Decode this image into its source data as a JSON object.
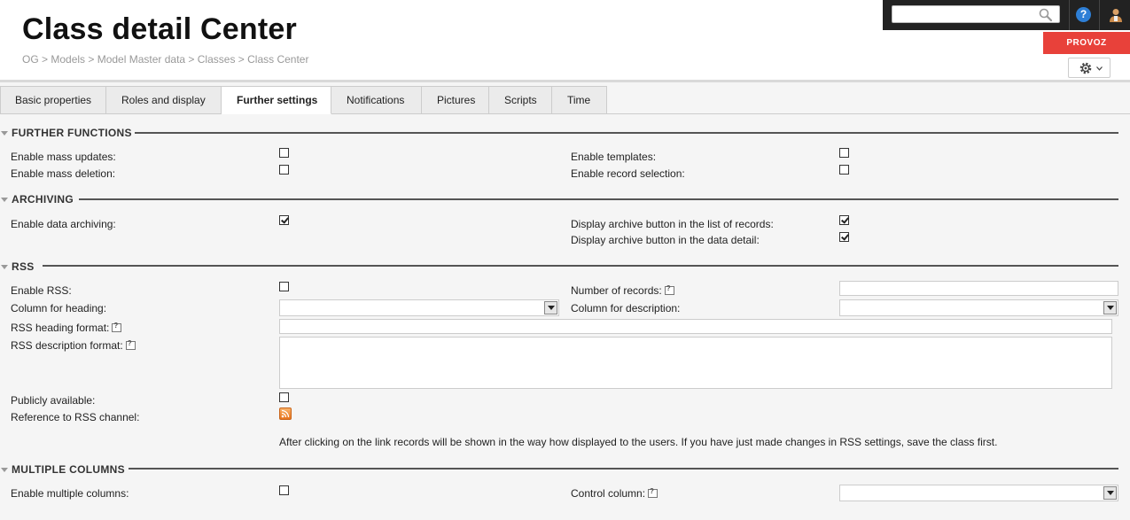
{
  "header": {
    "title": "Class detail Center",
    "breadcrumb": "OG > Models > Model Master data > Classes > Class Center",
    "search_value": "",
    "help_label": "?",
    "environment_badge": "PROVOZ"
  },
  "tabs": [
    {
      "label": "Basic properties",
      "active": false
    },
    {
      "label": "Roles and display",
      "active": false
    },
    {
      "label": "Further settings",
      "active": true
    },
    {
      "label": "Notifications",
      "active": false
    },
    {
      "label": "Pictures",
      "active": false
    },
    {
      "label": "Scripts",
      "active": false
    },
    {
      "label": "Time",
      "active": false
    }
  ],
  "further_functions": {
    "title": "FURTHER FUNCTIONS",
    "enable_mass_updates": {
      "label": "Enable mass updates:",
      "checked": false
    },
    "enable_mass_deletion": {
      "label": "Enable mass deletion:",
      "checked": false
    },
    "enable_templates": {
      "label": "Enable templates:",
      "checked": false
    },
    "enable_record_selection": {
      "label": "Enable record selection:",
      "checked": false
    }
  },
  "archiving": {
    "title": "ARCHIVING",
    "enable_data_archiving": {
      "label": "Enable data archiving:",
      "checked": true
    },
    "archive_button_list": {
      "label": "Display archive button in the list of records:",
      "checked": true
    },
    "archive_button_detail": {
      "label": "Display archive button in the data detail:",
      "checked": true
    }
  },
  "rss": {
    "title": "RSS",
    "enable_rss": {
      "label": "Enable RSS:",
      "checked": false
    },
    "number_of_records": {
      "label": "Number of records:",
      "value": ""
    },
    "column_for_heading": {
      "label": "Column for heading:",
      "value": ""
    },
    "column_for_description": {
      "label": "Column for description:",
      "value": ""
    },
    "heading_format": {
      "label": "RSS heading format:",
      "value": ""
    },
    "description_format": {
      "label": "RSS description format:",
      "value": ""
    },
    "publicly_available": {
      "label": "Publicly available:",
      "checked": false
    },
    "reference_to_channel": {
      "label": "Reference to RSS channel:"
    },
    "note": "After clicking on the link records will be shown in the way how displayed to the users. If you have just made changes in RSS settings, save the class first."
  },
  "multiple_columns": {
    "title": "MULTIPLE COLUMNS",
    "enable_multiple_columns": {
      "label": "Enable multiple columns:",
      "checked": false
    },
    "control_column": {
      "label": "Control column:",
      "value": ""
    }
  },
  "colors": {
    "accent_badge": "#e8413a",
    "topbar": "#222222",
    "help_icon": "#2e7fd6",
    "rss_icon": "#e8741c"
  }
}
